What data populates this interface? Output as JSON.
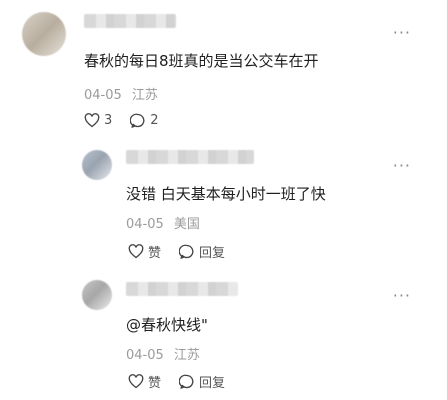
{
  "comments": [
    {
      "text": "春秋的每日8班真的是当公交车在开",
      "date": "04-05",
      "location": "江苏",
      "likes": "3",
      "replies": "2",
      "icons": {
        "like": "heart-icon",
        "reply": "comment-icon",
        "more": "more-icon"
      }
    },
    {
      "text": "没错 白天基本每小时一班了快",
      "date": "04-05",
      "location": "美国",
      "like_label": "赞",
      "reply_label": "回复"
    },
    {
      "text": "@春秋快线\"",
      "date": "04-05",
      "location": "江苏",
      "like_label": "赞",
      "reply_label": "回复"
    }
  ],
  "more_glyph": "···"
}
